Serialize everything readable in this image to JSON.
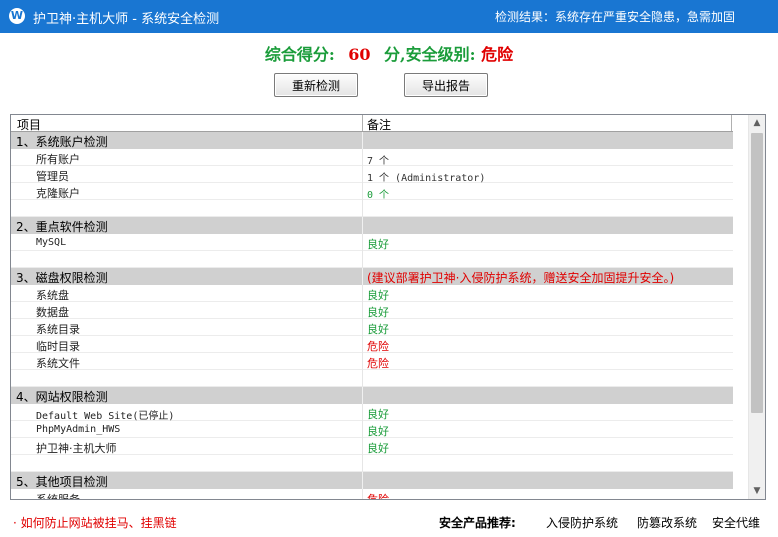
{
  "window": {
    "title": "护卫神·主机大师 - 系统安全检测",
    "result_text": "检测结果：系统存在严重安全隐患，急需加固"
  },
  "score": {
    "label": "综合得分:",
    "value": "60",
    "unit_level_label": "分,安全级别:",
    "level": "危险"
  },
  "buttons": {
    "rescan": "重新检测",
    "export": "导出报告"
  },
  "table": {
    "headers": {
      "item": "项目",
      "note": "备注"
    },
    "rows": [
      {
        "type": "section",
        "item": "1、系统账户检测",
        "note": "",
        "status": ""
      },
      {
        "type": "item",
        "item": "所有账户",
        "note": "7 个",
        "status": "count"
      },
      {
        "type": "item",
        "item": "管理员",
        "note": "1 个 (Administrator)",
        "status": "count"
      },
      {
        "type": "item",
        "item": "克隆账户",
        "note": "0 个",
        "status": "count-green"
      },
      {
        "type": "blank",
        "item": "",
        "note": "",
        "status": ""
      },
      {
        "type": "section",
        "item": "2、重点软件检测",
        "note": "",
        "status": ""
      },
      {
        "type": "item-mono",
        "item": "MySQL",
        "note": "良好",
        "status": "good"
      },
      {
        "type": "blank",
        "item": "",
        "note": "",
        "status": ""
      },
      {
        "type": "section",
        "item": "3、磁盘权限检测",
        "note": "(建议部署护卫神·入侵防护系统，赠送安全加固提升安全。)",
        "status": "advice"
      },
      {
        "type": "item",
        "item": "系统盘",
        "note": "良好",
        "status": "good"
      },
      {
        "type": "item",
        "item": "数据盘",
        "note": "良好",
        "status": "good"
      },
      {
        "type": "item",
        "item": "系统目录",
        "note": "良好",
        "status": "good"
      },
      {
        "type": "item",
        "item": "临时目录",
        "note": "危险",
        "status": "danger"
      },
      {
        "type": "item",
        "item": "系统文件",
        "note": "危险",
        "status": "danger"
      },
      {
        "type": "blank",
        "item": "",
        "note": "",
        "status": ""
      },
      {
        "type": "section",
        "item": "4、网站权限检测",
        "note": "",
        "status": ""
      },
      {
        "type": "item-mono",
        "item": "Default Web Site(已停止)",
        "note": "良好",
        "status": "good"
      },
      {
        "type": "item-mono",
        "item": "PhpMyAdmin_HWS",
        "note": "良好",
        "status": "good"
      },
      {
        "type": "item",
        "item": "护卫神·主机大师",
        "note": "良好",
        "status": "good"
      },
      {
        "type": "blank",
        "item": "",
        "note": "",
        "status": ""
      },
      {
        "type": "section",
        "item": "5、其他项目检测",
        "note": "",
        "status": ""
      },
      {
        "type": "item",
        "item": "系统服务",
        "note": "危险",
        "status": "danger"
      }
    ]
  },
  "footer": {
    "link": "· 如何防止网站被挂马、挂黑链",
    "recommend_label": "安全产品推荐:",
    "products": [
      "入侵防护系统",
      "防篡改系统",
      "安全代维"
    ]
  },
  "colors": {
    "titlebar": "#1976d2",
    "good": "#1a9c3a",
    "danger": "#e00000",
    "section_bg": "#d0d0d0"
  }
}
